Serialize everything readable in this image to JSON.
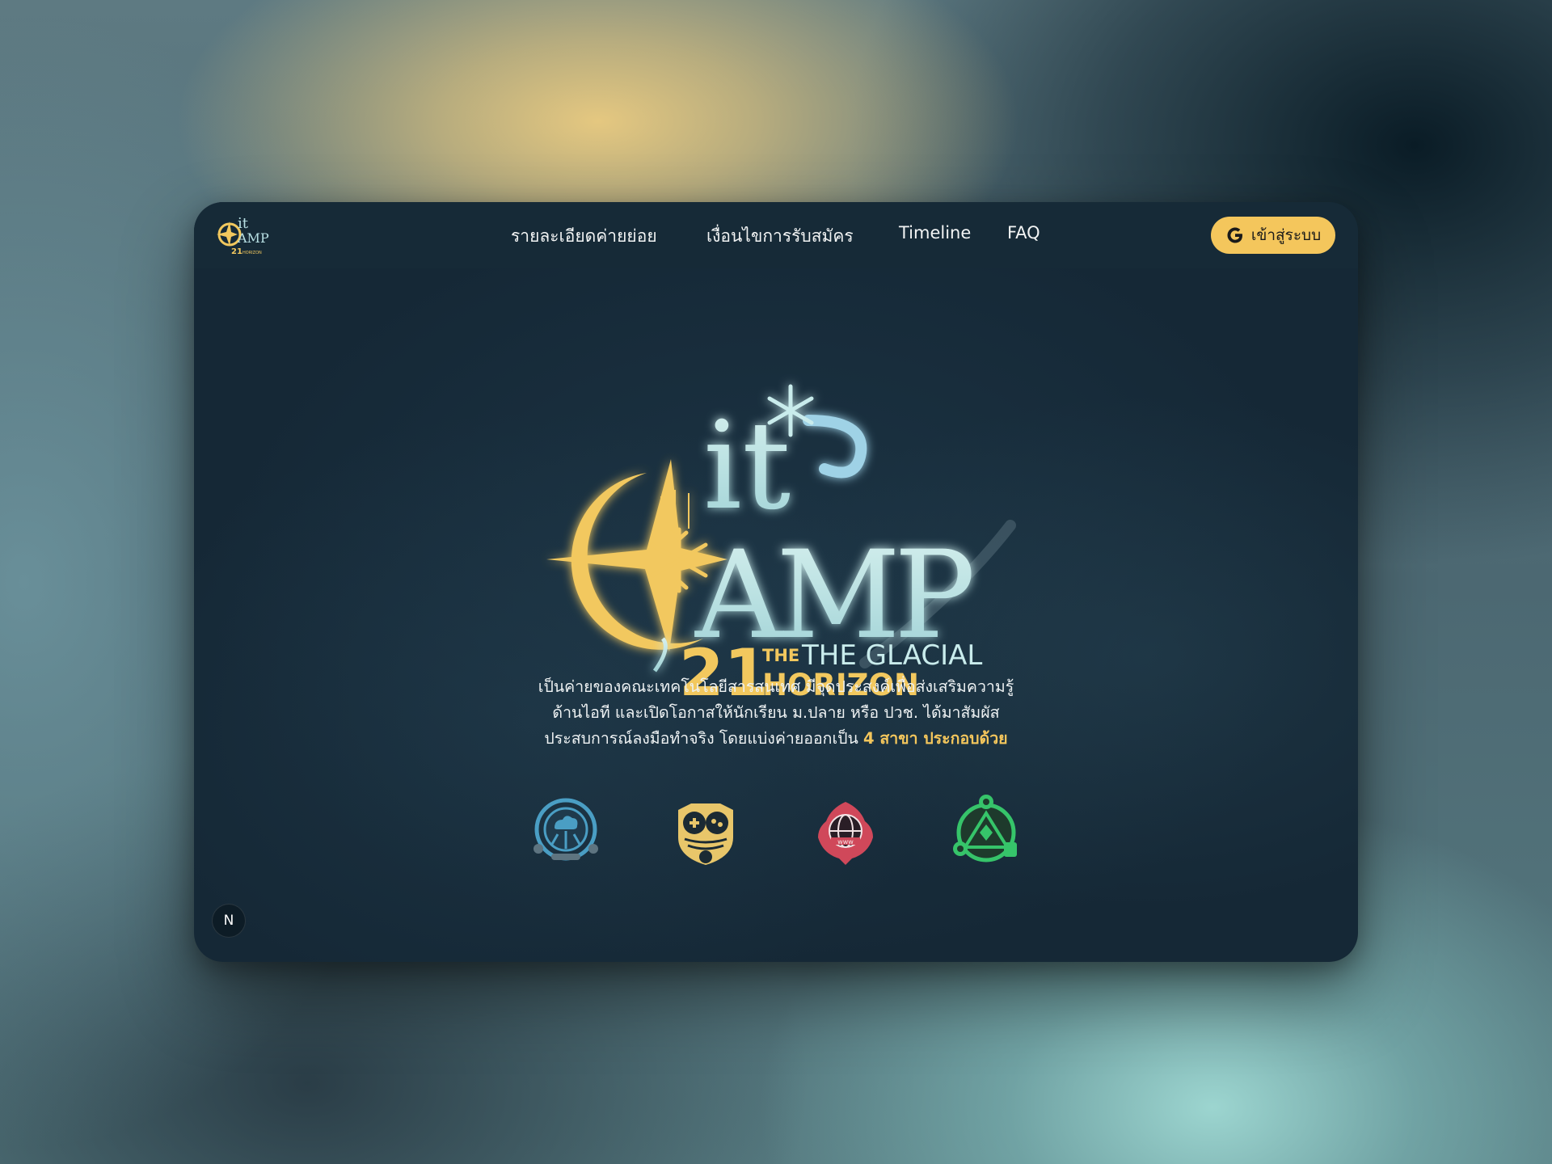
{
  "nav": {
    "links": [
      {
        "label": "รายละเอียดค่ายย่อย"
      },
      {
        "label": "เงื่อนไขการรับสมัคร"
      },
      {
        "label": "Timeline"
      },
      {
        "label": "FAQ"
      }
    ],
    "login_label": "เข้าสู่ระบบ",
    "login_icon": "google-icon"
  },
  "hero": {
    "logo_title": "itCAMP",
    "logo_number": "21",
    "logo_subtitle_top": "THE GLACIAL",
    "logo_subtitle_bottom": "HORIZON"
  },
  "description": {
    "line1": "เป็นค่ายของคณะเทคโนโลยีสารสนเทศ มีจุดประสงค์เพื่อส่งเสริมความรู้",
    "line2": "ด้านไอที และเปิดโอกาสให้นักเรียน ม.ปลาย หรือ ปวช. ได้มาสัมผัส",
    "line3": "ประสบการณ์ลงมือทำจริง โดยแบ่งค่ายออกเป็น ",
    "highlight": "4 สาขา ประกอบด้วย"
  },
  "badges": [
    {
      "icon": "cloud-circuit-icon",
      "color": "#4a9ec4"
    },
    {
      "icon": "gamepad-owl-icon",
      "color": "#e8c66a"
    },
    {
      "icon": "globe-www-icon",
      "color": "#d0485a"
    },
    {
      "icon": "gear-triangle-icon",
      "color": "#36c46a"
    }
  ],
  "corner_badge": "N",
  "colors": {
    "accent": "#f4c65c",
    "window_bg": "#152836",
    "logo_ice": "#b8e0e4",
    "logo_gold": "#f2c85e"
  }
}
